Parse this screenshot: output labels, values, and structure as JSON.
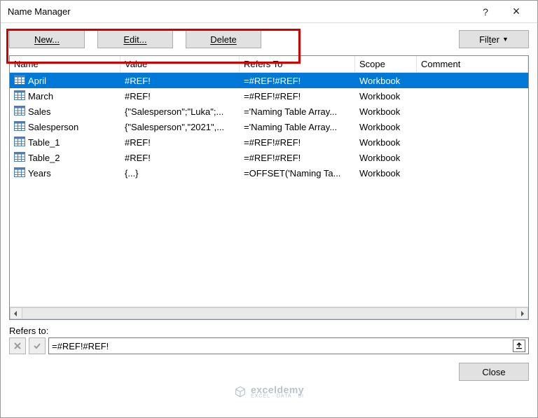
{
  "window": {
    "title": "Name Manager",
    "help": "?",
    "close": "×"
  },
  "toolbar": {
    "new_label": "New...",
    "edit_label": "Edit...",
    "delete_label": "Delete",
    "filter_full": "Filter ▾",
    "filter_prefix": "Fil",
    "filter_u": "t",
    "filter_suffix": "er"
  },
  "columns": {
    "name": "Name",
    "value": "Value",
    "refers": "Refers To",
    "scope": "Scope",
    "comment": "Comment"
  },
  "rows": [
    {
      "name": "April",
      "value": "#REF!",
      "refers": "=#REF!#REF!",
      "scope": "Workbook",
      "selected": true
    },
    {
      "name": "March",
      "value": "#REF!",
      "refers": "=#REF!#REF!",
      "scope": "Workbook"
    },
    {
      "name": "Sales",
      "value": "{\"Salesperson\";\"Luka\";...",
      "refers": "='Naming Table Array...",
      "scope": "Workbook"
    },
    {
      "name": "Salesperson",
      "value": "{\"Salesperson\",\"2021\",...",
      "refers": "='Naming Table Array...",
      "scope": "Workbook"
    },
    {
      "name": "Table_1",
      "value": "#REF!",
      "refers": "=#REF!#REF!",
      "scope": "Workbook"
    },
    {
      "name": "Table_2",
      "value": "#REF!",
      "refers": "=#REF!#REF!",
      "scope": "Workbook"
    },
    {
      "name": "Years",
      "value": "{...}",
      "refers": "=OFFSET('Naming Ta...",
      "scope": "Workbook"
    }
  ],
  "refers_section": {
    "label": "Refers to:",
    "value": "=#REF!#REF!"
  },
  "footer": {
    "close_label": "Close"
  },
  "watermark": {
    "brand": "exceldemy",
    "tagline": "EXCEL · DATA · BI"
  }
}
